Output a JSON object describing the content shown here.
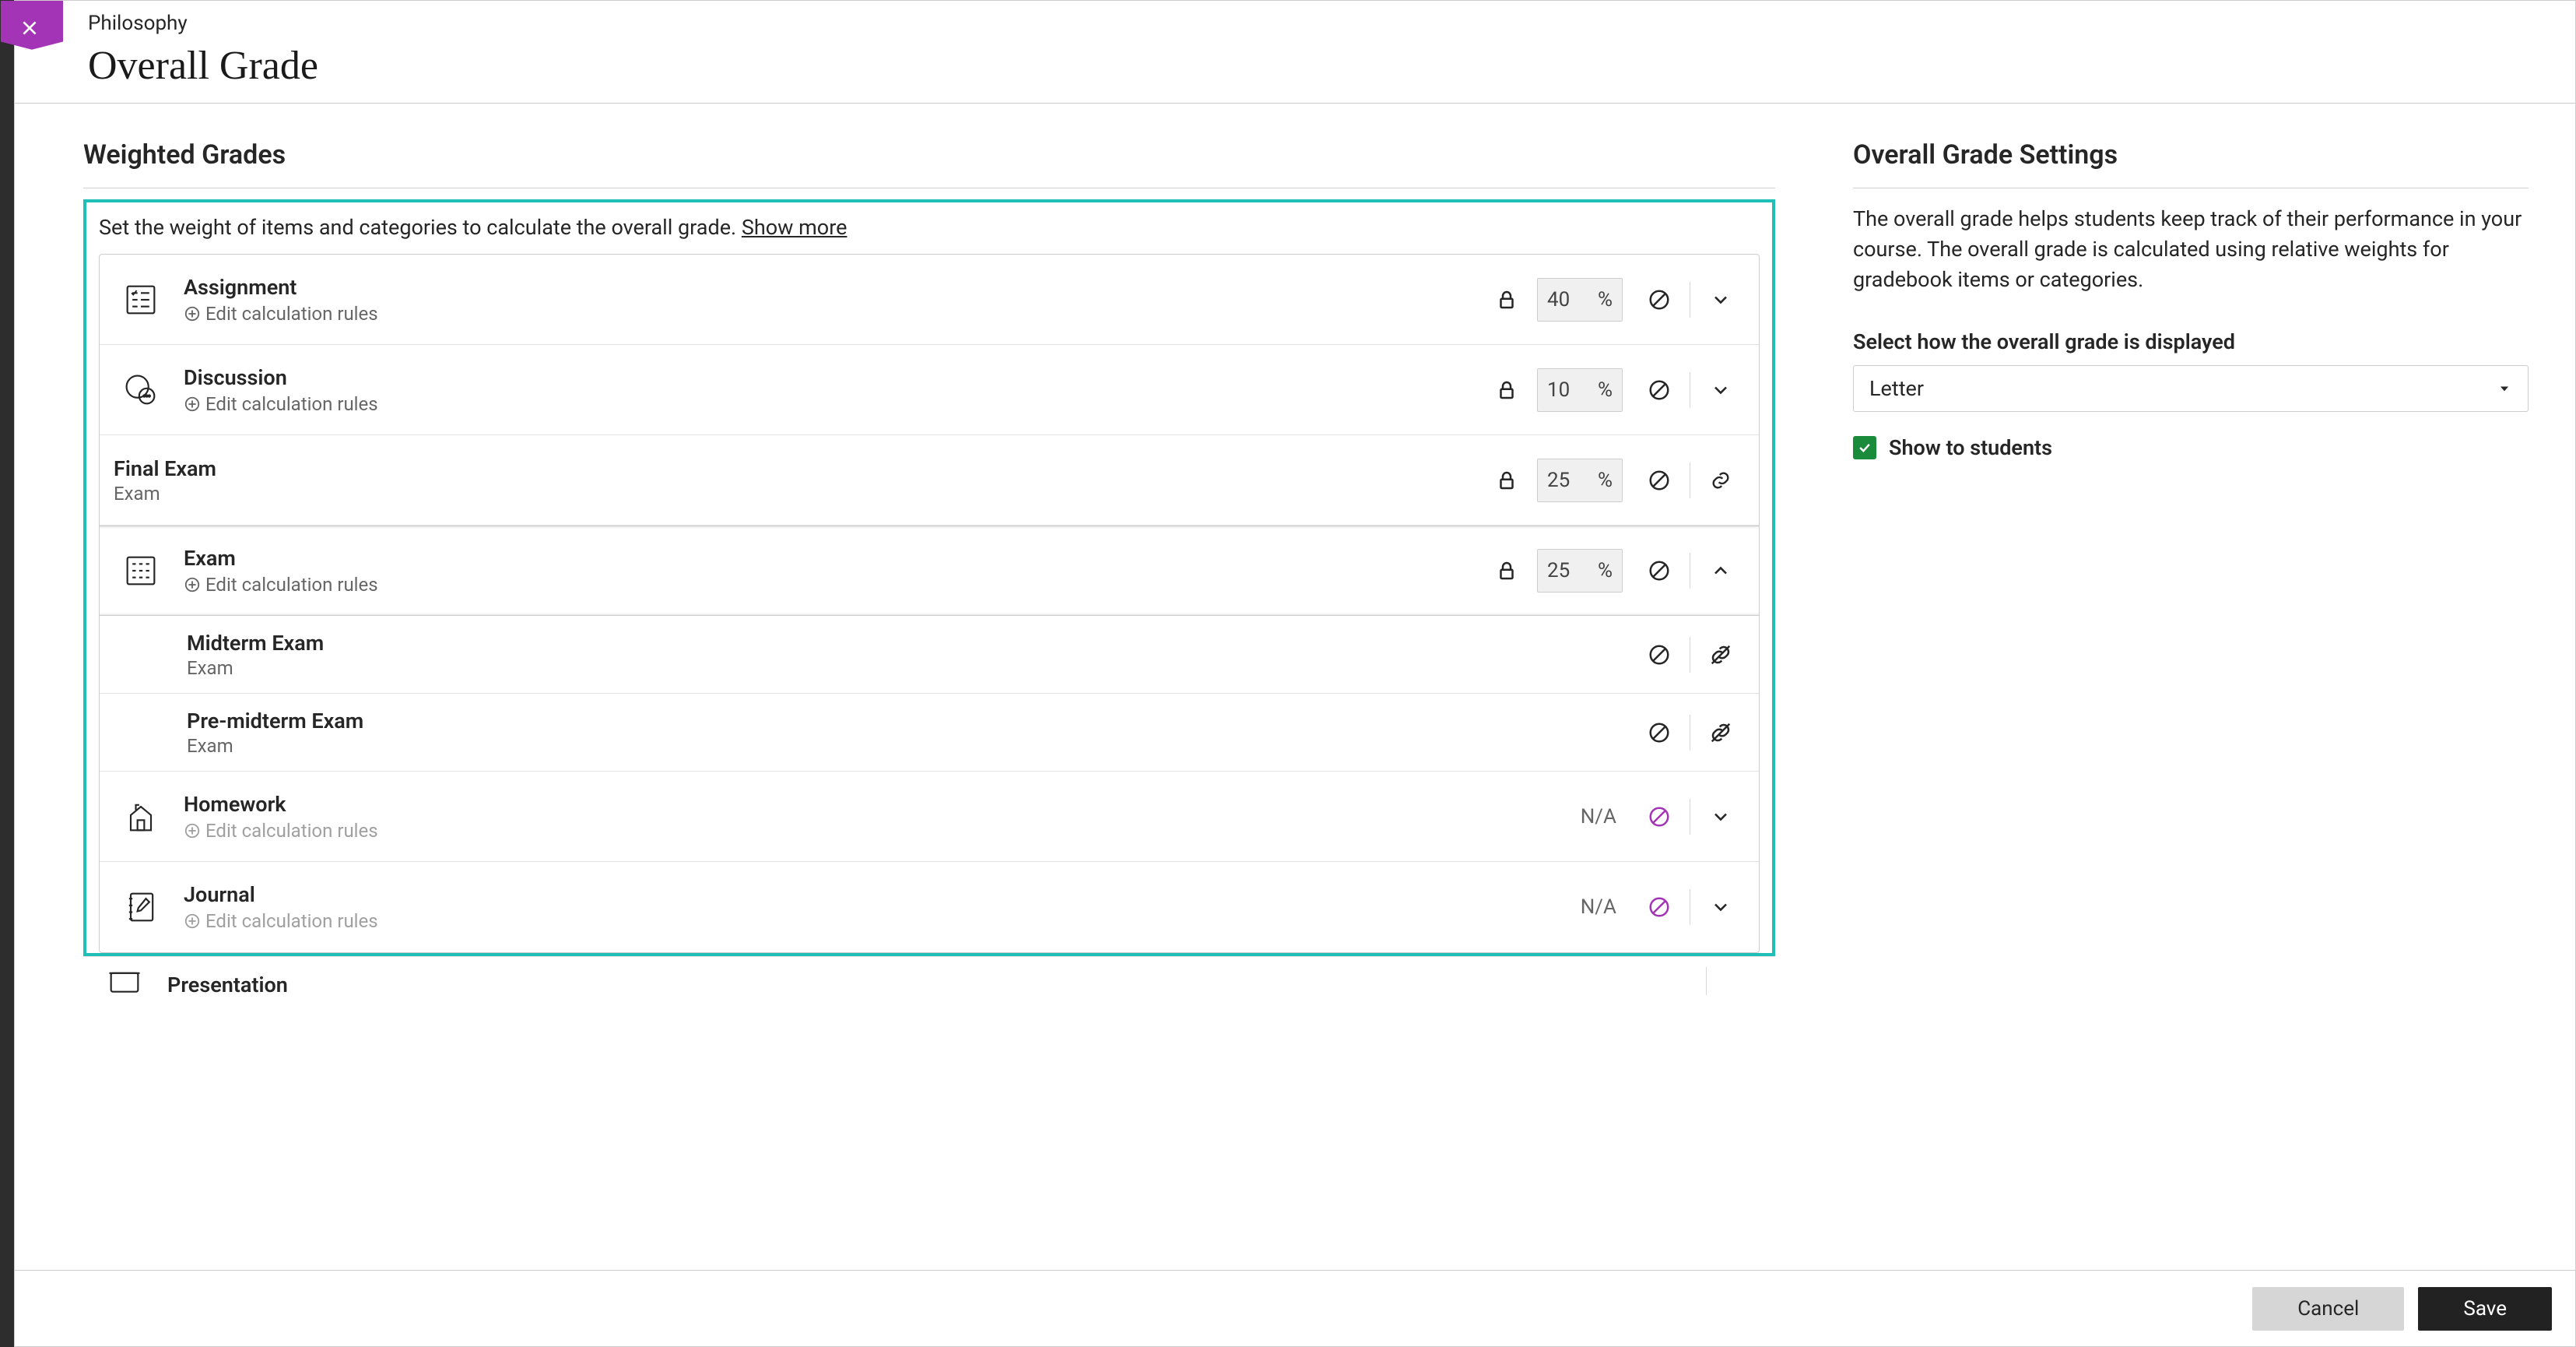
{
  "header": {
    "crumb": "Philosophy",
    "title": "Overall Grade"
  },
  "left": {
    "heading": "Weighted Grades",
    "instruction": "Set the weight of items and categories to calculate the overall grade.  ",
    "show_more": "Show more",
    "edit_rules_label": "Edit calculation rules",
    "percent_symbol": "%",
    "na_label": "N/A",
    "categories": [
      {
        "id": "assignment",
        "title": "Assignment",
        "edit_rules": true,
        "weight": "40",
        "locked": true,
        "excluded": false,
        "expand": "down",
        "has_icon": true
      },
      {
        "id": "discussion",
        "title": "Discussion",
        "edit_rules": true,
        "weight": "10",
        "locked": true,
        "excluded": false,
        "expand": "down",
        "has_icon": true
      },
      {
        "id": "final-exam",
        "title": "Final Exam",
        "subtitle": "Exam",
        "edit_rules": false,
        "weight": "25",
        "locked": true,
        "excluded": false,
        "expand": "link",
        "has_icon": false
      },
      {
        "id": "exam",
        "title": "Exam",
        "edit_rules": true,
        "weight": "25",
        "locked": true,
        "excluded": false,
        "expand": "up",
        "has_icon": true
      },
      {
        "id": "midterm",
        "title": "Midterm Exam",
        "subtitle": "Exam",
        "sub": true,
        "excluded": false,
        "unlink": true
      },
      {
        "id": "premidterm",
        "title": "Pre-midterm Exam",
        "subtitle": "Exam",
        "sub": true,
        "excluded": false,
        "unlink": true
      },
      {
        "id": "homework",
        "title": "Homework",
        "edit_rules": true,
        "edit_disabled": true,
        "na": true,
        "excluded": true,
        "expand": "down",
        "has_icon": true
      },
      {
        "id": "journal",
        "title": "Journal",
        "edit_rules": true,
        "edit_disabled": true,
        "na": true,
        "excluded": true,
        "expand": "down",
        "has_icon": true
      }
    ],
    "overflow_title": "Presentation"
  },
  "right": {
    "heading": "Overall Grade Settings",
    "description": "The overall grade helps students keep track of their performance in your course. The overall grade is calculated using relative weights for gradebook items or categories.",
    "select_header": "Select how the overall grade is displayed",
    "select_value": "Letter",
    "show_label": "Show to students",
    "show_checked": true
  },
  "footer": {
    "cancel": "Cancel",
    "save": "Save"
  },
  "icons": {
    "lock": "lock-icon",
    "prohibit": "prohibit-icon",
    "link": "link-icon",
    "unlink": "unlink-icon"
  }
}
